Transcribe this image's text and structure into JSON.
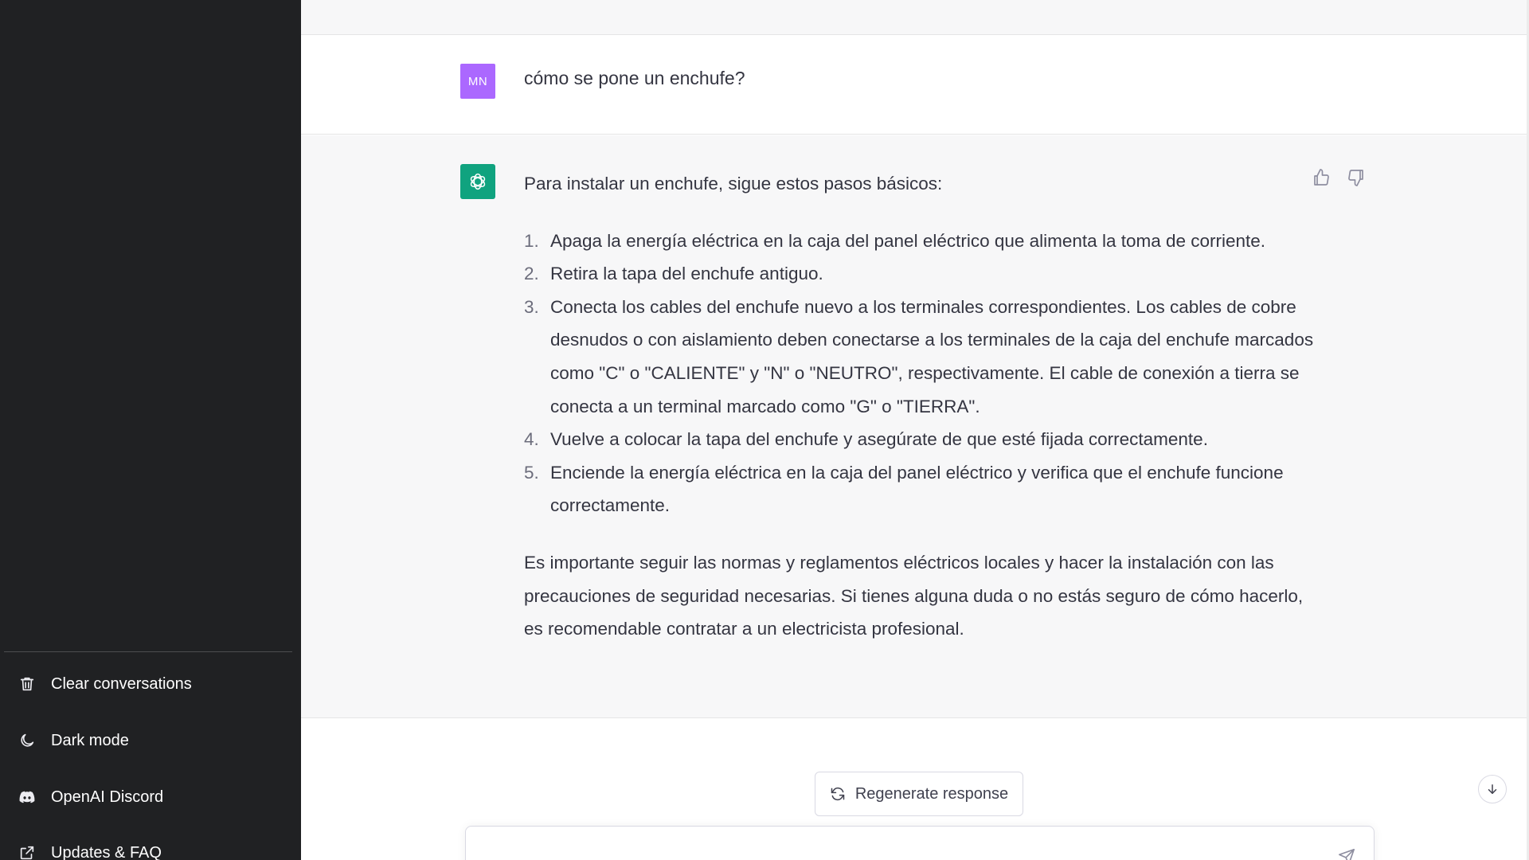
{
  "sidebar": {
    "items": [
      {
        "label": "Clear conversations",
        "icon": "trash-icon"
      },
      {
        "label": "Dark mode",
        "icon": "moon-icon"
      },
      {
        "label": "OpenAI Discord",
        "icon": "discord-icon"
      },
      {
        "label": "Updates & FAQ",
        "icon": "external-link-icon"
      }
    ]
  },
  "conversation": {
    "user": {
      "initials": "MN",
      "message": "cómo se pone un enchufe?",
      "avatar_color": "#ab68ff"
    },
    "assistant": {
      "avatar_color": "#10a37f",
      "intro": "Para instalar un enchufe, sigue estos pasos básicos:",
      "steps": [
        {
          "num": "1.",
          "text": "Apaga la energía eléctrica en la caja del panel eléctrico que alimenta la toma de corriente."
        },
        {
          "num": "2.",
          "text": "Retira la tapa del enchufe antiguo."
        },
        {
          "num": "3.",
          "text": "Conecta los cables del enchufe nuevo a los terminales correspondientes. Los cables de cobre desnudos o con aislamiento deben conectarse a los terminales de la caja del enchufe marcados como \"C\" o \"CALIENTE\" y \"N\" o \"NEUTRO\", respectivamente. El cable de conexión a tierra se conecta a un terminal marcado como \"G\" o \"TIERRA\"."
        },
        {
          "num": "4.",
          "text": "Vuelve a colocar la tapa del enchufe y asegúrate de que esté fijada correctamente."
        },
        {
          "num": "5.",
          "text": "Enciende la energía eléctrica en la caja del panel eléctrico y verifica que el enchufe funcione correctamente."
        }
      ],
      "closing": "Es importante seguir las normas y reglamentos eléctricos locales y hacer la instalación con las precauciones de seguridad necesarias. Si tienes alguna duda o no estás seguro de cómo hacerlo, es recomendable contratar a un electricista profesional."
    }
  },
  "footer": {
    "regenerate_label": "Regenerate response",
    "input_value": ""
  }
}
